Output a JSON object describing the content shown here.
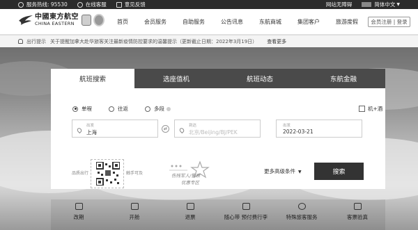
{
  "topbar": {
    "hotline": "服务热线: 95530",
    "online_service": "在线客服",
    "feedback": "意见反馈",
    "accessibility": "网站无障碍",
    "language": "简体中文"
  },
  "header": {
    "logo_cn": "中國東方航空",
    "logo_en": "CHINA EASTERN",
    "nav": [
      "首页",
      "会员服务",
      "自助服务",
      "公告讯息",
      "东航商城",
      "集团客户",
      "旅游度假"
    ],
    "login": "会员注册 | 登录"
  },
  "notice": {
    "label": "出行提示",
    "text": "关于提醒加拿大赴华旅客关注最新疫情防控要求的温馨提示（更新截止日期：2022年3月19日）",
    "more": "查看更多"
  },
  "booking": {
    "tabs": [
      "航班搜索",
      "选座值机",
      "航班动态",
      "东航金融"
    ],
    "active_tab": 0,
    "trip_types": [
      "单程",
      "往返",
      "多段"
    ],
    "selected_trip": 0,
    "flight_hotel": "机+酒",
    "from": {
      "label": "出发",
      "value": "上海"
    },
    "to": {
      "label": "到达",
      "placeholder": "北京/Beijing/BJ/PEK"
    },
    "date": {
      "label": "出发",
      "value": "2022-03-21"
    },
    "qr_left": "品质出行",
    "qr_right": "触手可及",
    "promo_line1": "伤残军人/警察",
    "promo_line2": "优惠专区",
    "more_options": "更多高级条件",
    "search": "搜索"
  },
  "services": [
    "改期",
    "开舱",
    "退票",
    "随心带 预付费行李",
    "特殊旅客服务",
    "客票验真"
  ]
}
